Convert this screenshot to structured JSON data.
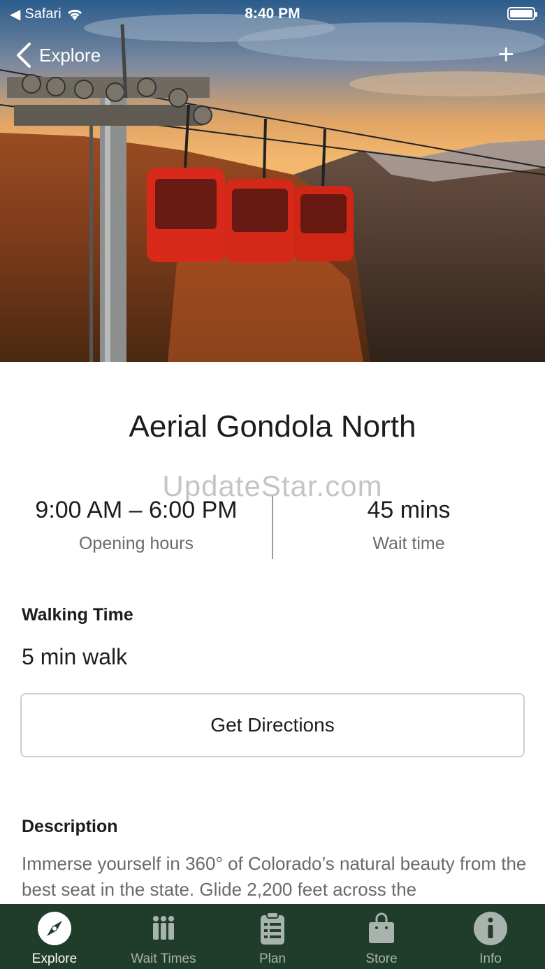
{
  "status_bar": {
    "back_app": "Safari",
    "time": "8:40 PM"
  },
  "nav": {
    "back_label": "Explore"
  },
  "attraction": {
    "title": "Aerial Gondola North",
    "watermark": "UpdateStar.com",
    "opening_hours": {
      "value": "9:00 AM – 6:00 PM",
      "label": "Opening hours"
    },
    "wait_time": {
      "value": "45 mins",
      "label": "Wait time"
    }
  },
  "walking": {
    "heading": "Walking Time",
    "value": "5 min walk"
  },
  "directions_button": "Get Directions",
  "description": {
    "heading": "Description",
    "text": "Immerse yourself in 360° of Colorado’s natural beauty from the best seat in the state. Glide 2,200 feet across the"
  },
  "tabs": [
    {
      "label": "Explore",
      "icon": "compass-icon",
      "active": true
    },
    {
      "label": "Wait Times",
      "icon": "people-icon",
      "active": false
    },
    {
      "label": "Plan",
      "icon": "clipboard-icon",
      "active": false
    },
    {
      "label": "Store",
      "icon": "bag-icon",
      "active": false
    },
    {
      "label": "Info",
      "icon": "info-icon",
      "active": false
    }
  ],
  "colors": {
    "tabbar_bg": "#203d2c",
    "tab_active": "#ffffff",
    "tab_inactive": "#a9b3ad"
  }
}
